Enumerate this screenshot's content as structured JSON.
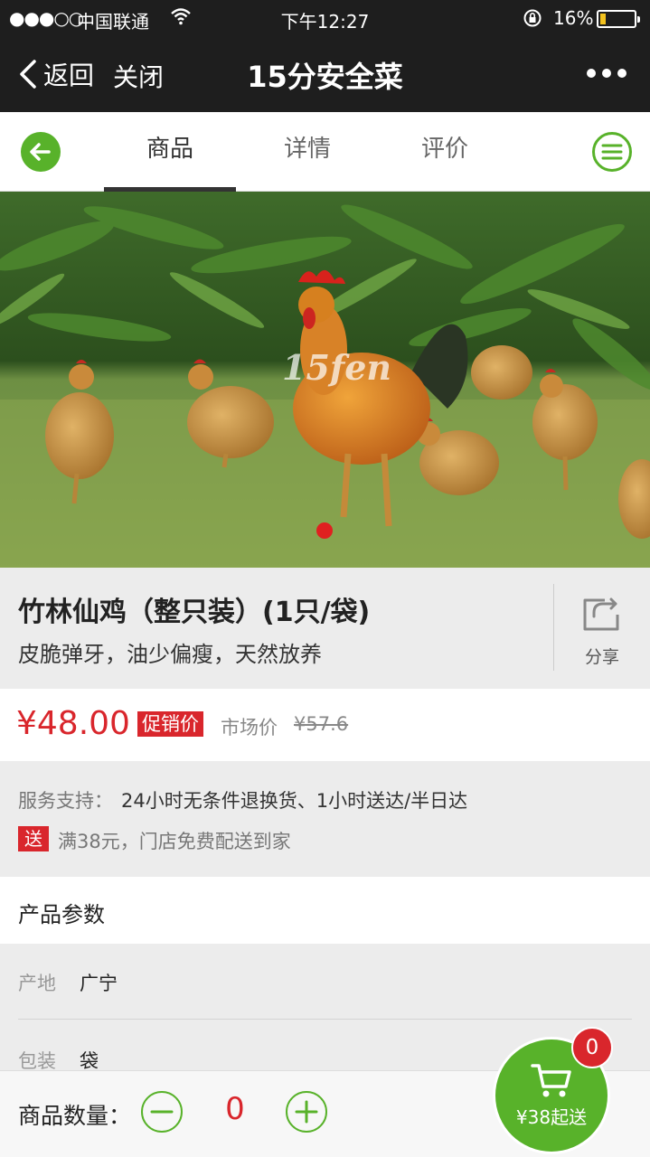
{
  "status_bar": {
    "signal": "●●●○○",
    "carrier": "中国联通",
    "time": "下午12:27",
    "battery_pct": "16%",
    "battery_level": 0.16,
    "battery_color": "#f3c21e"
  },
  "nav": {
    "back_label": "返回",
    "close_label": "关闭",
    "title": "15分安全菜",
    "more_icon": "more-dots-icon"
  },
  "tabs": [
    {
      "label": "商品",
      "active": true
    },
    {
      "label": "详情",
      "active": false
    },
    {
      "label": "评价",
      "active": false
    }
  ],
  "hero": {
    "watermark": "15fen",
    "carousel_index": 1,
    "carousel_total": 1
  },
  "product": {
    "name": "竹林仙鸡（整只装）(1只/袋)",
    "desc": "皮脆弹牙，油少偏瘦，天然放养",
    "share_label": "分享"
  },
  "price": {
    "current": "¥48.00",
    "promo_label": "促销价",
    "market_label": "市场价",
    "market_price": "¥57.6"
  },
  "service": {
    "label": "服务支持：",
    "value": "24小时无条件退换货、1小时送达/半日达",
    "badge": "送",
    "delivery": "满38元，门店免费配送到家"
  },
  "params": {
    "title": "产品参数",
    "rows": [
      {
        "key": "产地",
        "value": "广宁"
      },
      {
        "key": "包装",
        "value": "袋"
      }
    ]
  },
  "bottom": {
    "qty_label": "商品数量：",
    "qty": "0",
    "cart_label": "¥38起送",
    "cart_count": "0"
  },
  "colors": {
    "accent_green": "#58b22a",
    "price_red": "#d9262c",
    "nav_bg": "#1e1e1e"
  }
}
